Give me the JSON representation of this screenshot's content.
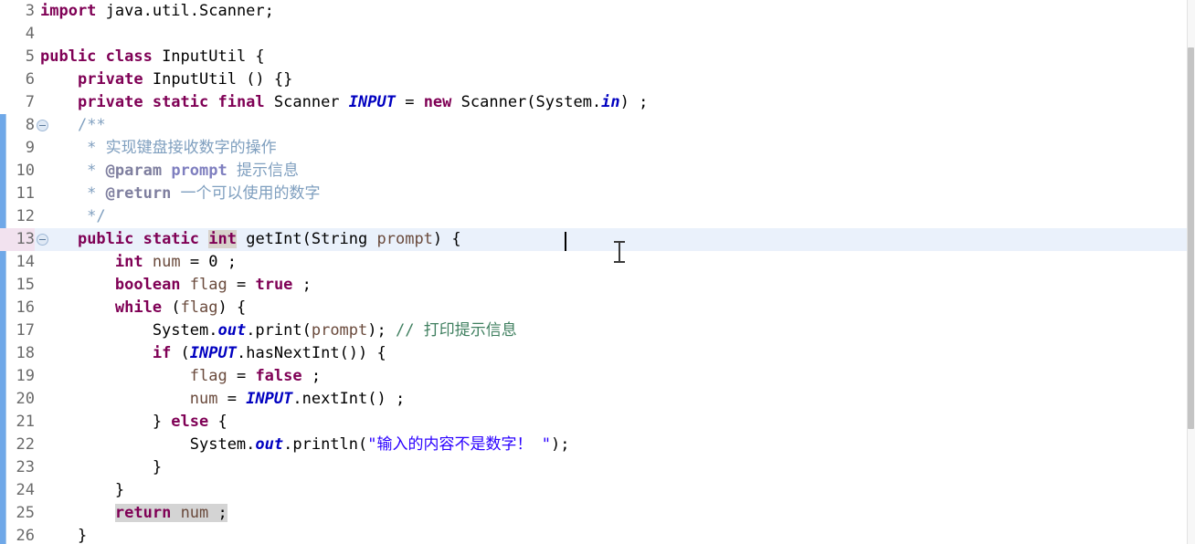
{
  "editor": {
    "language": "Java",
    "class_name": "InputUtil",
    "first_visible_line": 3,
    "last_visible_line": 26,
    "current_line": 13,
    "fold_marker_lines": [
      8,
      13
    ],
    "change_bar_start_line": 8,
    "caret_line": 13,
    "caret_column_text": "public static int getInt(String prompt) { ",
    "highlighted_selection_text": "return num ;",
    "occurrence_highlight_token": "int",
    "colors": {
      "background": "#ffffff",
      "current_line_background": "#eaf1fb",
      "current_lineno_background": "#f2e2ef",
      "keyword": "#7f0055",
      "string": "#2a00ff",
      "comment": "#3f7f5f",
      "javadoc": "#7f9fbf",
      "javadoc_tag": "#7f7f9f",
      "static_field": "#0000c0",
      "local_variable": "#6a4a3c",
      "line_number": "#6b6b6b",
      "change_bar": "#6fa8e8",
      "selection_highlight": "#d4d4d4",
      "occurrence_highlight": "#d8d2cb",
      "scrollbar_thumb": "#c4c4c4"
    },
    "lines": [
      {
        "n": "3",
        "fold": false,
        "current": false,
        "tokens": [
          {
            "t": "import ",
            "c": "kw"
          },
          {
            "t": "java.util.Scanner;",
            "c": "plain"
          }
        ]
      },
      {
        "n": "4",
        "fold": false,
        "current": false,
        "tokens": []
      },
      {
        "n": "5",
        "fold": false,
        "current": false,
        "tokens": [
          {
            "t": "public class ",
            "c": "kw"
          },
          {
            "t": "InputUtil {",
            "c": "plain"
          }
        ]
      },
      {
        "n": "6",
        "fold": false,
        "current": false,
        "tokens": [
          {
            "t": "    ",
            "c": "plain"
          },
          {
            "t": "private ",
            "c": "kw"
          },
          {
            "t": "InputUtil () {}",
            "c": "plain"
          }
        ]
      },
      {
        "n": "7",
        "fold": false,
        "current": false,
        "tokens": [
          {
            "t": "    ",
            "c": "plain"
          },
          {
            "t": "private static final ",
            "c": "kw"
          },
          {
            "t": "Scanner ",
            "c": "plain"
          },
          {
            "t": "INPUT",
            "c": "field"
          },
          {
            "t": " = ",
            "c": "plain"
          },
          {
            "t": "new ",
            "c": "kw"
          },
          {
            "t": "Scanner(System.",
            "c": "plain"
          },
          {
            "t": "in",
            "c": "field"
          },
          {
            "t": ") ;",
            "c": "plain"
          }
        ]
      },
      {
        "n": "8",
        "fold": true,
        "current": false,
        "tokens": [
          {
            "t": "    ",
            "c": "plain"
          },
          {
            "t": "/**",
            "c": "jdoc"
          }
        ]
      },
      {
        "n": "9",
        "fold": false,
        "current": false,
        "tokens": [
          {
            "t": "     * ",
            "c": "jdoc"
          },
          {
            "t": "实现键盘接收数字的操作",
            "c": "jdoc"
          }
        ]
      },
      {
        "n": "10",
        "fold": false,
        "current": false,
        "tokens": [
          {
            "t": "     * ",
            "c": "jdoc"
          },
          {
            "t": "@param ",
            "c": "jdockw"
          },
          {
            "t": "prompt",
            "c": "jdocparam"
          },
          {
            "t": " 提示信息",
            "c": "jdoc"
          }
        ]
      },
      {
        "n": "11",
        "fold": false,
        "current": false,
        "tokens": [
          {
            "t": "     * ",
            "c": "jdoc"
          },
          {
            "t": "@return",
            "c": "jdockw"
          },
          {
            "t": " 一个可以使用的数字",
            "c": "jdoc"
          }
        ]
      },
      {
        "n": "12",
        "fold": false,
        "current": false,
        "tokens": [
          {
            "t": "     */",
            "c": "jdoc"
          }
        ]
      },
      {
        "n": "13",
        "fold": true,
        "current": true,
        "tokens": [
          {
            "t": "    ",
            "c": "plain"
          },
          {
            "t": "public static ",
            "c": "kw"
          },
          {
            "t": "int",
            "c": "kw hl-occ"
          },
          {
            "t": " getInt(String ",
            "c": "plain"
          },
          {
            "t": "prompt",
            "c": "var"
          },
          {
            "t": ") { ",
            "c": "plain"
          }
        ]
      },
      {
        "n": "14",
        "fold": false,
        "current": false,
        "tokens": [
          {
            "t": "        ",
            "c": "plain"
          },
          {
            "t": "int",
            "c": "kw"
          },
          {
            "t": " ",
            "c": "plain"
          },
          {
            "t": "num",
            "c": "var"
          },
          {
            "t": " = ",
            "c": "plain"
          },
          {
            "t": "0",
            "c": "plain"
          },
          {
            "t": " ;",
            "c": "plain"
          }
        ]
      },
      {
        "n": "15",
        "fold": false,
        "current": false,
        "tokens": [
          {
            "t": "        ",
            "c": "plain"
          },
          {
            "t": "boolean",
            "c": "kw"
          },
          {
            "t": " ",
            "c": "plain"
          },
          {
            "t": "flag",
            "c": "var"
          },
          {
            "t": " = ",
            "c": "plain"
          },
          {
            "t": "true",
            "c": "kw"
          },
          {
            "t": " ;",
            "c": "plain"
          }
        ]
      },
      {
        "n": "16",
        "fold": false,
        "current": false,
        "tokens": [
          {
            "t": "        ",
            "c": "plain"
          },
          {
            "t": "while",
            "c": "kw"
          },
          {
            "t": " (",
            "c": "plain"
          },
          {
            "t": "flag",
            "c": "var"
          },
          {
            "t": ") {",
            "c": "plain"
          }
        ]
      },
      {
        "n": "17",
        "fold": false,
        "current": false,
        "tokens": [
          {
            "t": "            System.",
            "c": "plain"
          },
          {
            "t": "out",
            "c": "field"
          },
          {
            "t": ".print(",
            "c": "plain"
          },
          {
            "t": "prompt",
            "c": "var"
          },
          {
            "t": "); ",
            "c": "plain"
          },
          {
            "t": "// 打印提示信息",
            "c": "cmt"
          }
        ]
      },
      {
        "n": "18",
        "fold": false,
        "current": false,
        "tokens": [
          {
            "t": "            ",
            "c": "plain"
          },
          {
            "t": "if",
            "c": "kw"
          },
          {
            "t": " (",
            "c": "plain"
          },
          {
            "t": "INPUT",
            "c": "field"
          },
          {
            "t": ".hasNextInt()) {",
            "c": "plain"
          }
        ]
      },
      {
        "n": "19",
        "fold": false,
        "current": false,
        "tokens": [
          {
            "t": "                ",
            "c": "plain"
          },
          {
            "t": "flag",
            "c": "var"
          },
          {
            "t": " = ",
            "c": "plain"
          },
          {
            "t": "false",
            "c": "kw"
          },
          {
            "t": " ;",
            "c": "plain"
          }
        ]
      },
      {
        "n": "20",
        "fold": false,
        "current": false,
        "tokens": [
          {
            "t": "                ",
            "c": "plain"
          },
          {
            "t": "num",
            "c": "var"
          },
          {
            "t": " = ",
            "c": "plain"
          },
          {
            "t": "INPUT",
            "c": "field"
          },
          {
            "t": ".nextInt() ;",
            "c": "plain"
          }
        ]
      },
      {
        "n": "21",
        "fold": false,
        "current": false,
        "tokens": [
          {
            "t": "            } ",
            "c": "plain"
          },
          {
            "t": "else",
            "c": "kw"
          },
          {
            "t": " {",
            "c": "plain"
          }
        ]
      },
      {
        "n": "22",
        "fold": false,
        "current": false,
        "tokens": [
          {
            "t": "                System.",
            "c": "plain"
          },
          {
            "t": "out",
            "c": "field"
          },
          {
            "t": ".println(",
            "c": "plain"
          },
          {
            "t": "\"输入的内容不是数字！ \"",
            "c": "str"
          },
          {
            "t": ");",
            "c": "plain"
          }
        ]
      },
      {
        "n": "23",
        "fold": false,
        "current": false,
        "tokens": [
          {
            "t": "            }",
            "c": "plain"
          }
        ]
      },
      {
        "n": "24",
        "fold": false,
        "current": false,
        "tokens": [
          {
            "t": "        }",
            "c": "plain"
          }
        ]
      },
      {
        "n": "25",
        "fold": false,
        "current": false,
        "tokens": [
          {
            "t": "        ",
            "c": "plain"
          },
          {
            "t": "return",
            "c": "kw hl"
          },
          {
            "t": " ",
            "c": "hl"
          },
          {
            "t": "num",
            "c": "var hl"
          },
          {
            "t": " ;",
            "c": "hl"
          }
        ]
      },
      {
        "n": "26",
        "fold": false,
        "current": false,
        "tokens": [
          {
            "t": "    }",
            "c": "plain"
          }
        ]
      }
    ]
  }
}
